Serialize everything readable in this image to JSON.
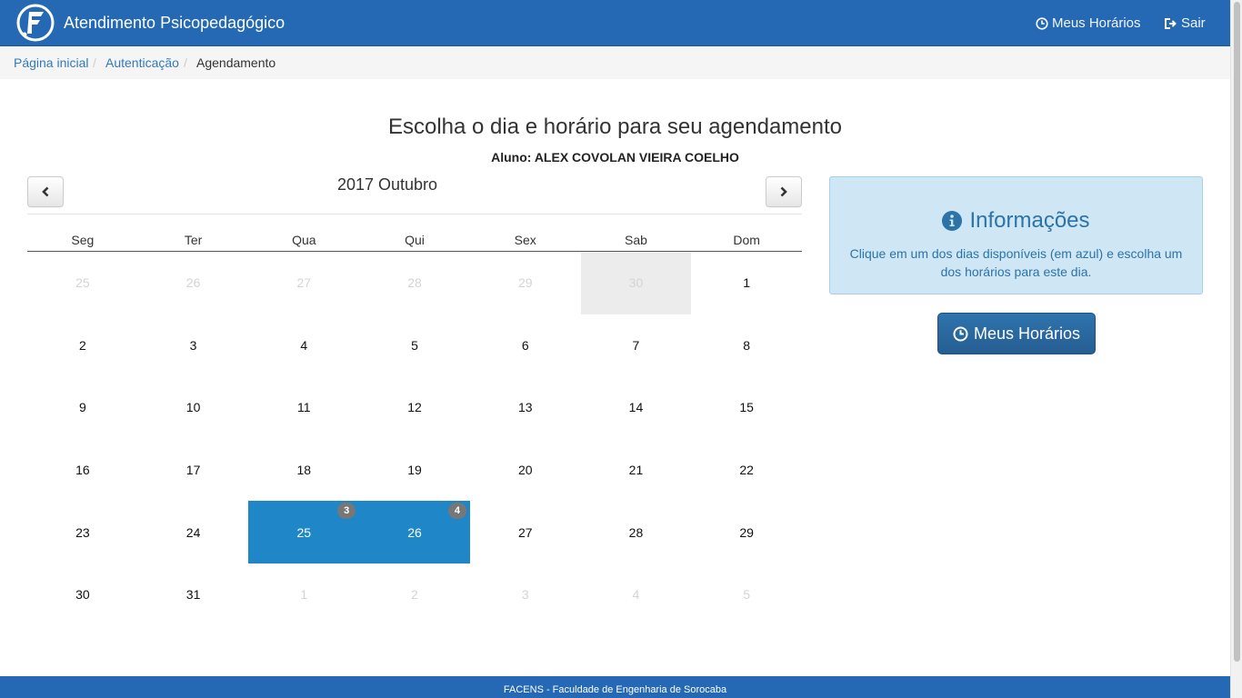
{
  "navbar": {
    "title": "Atendimento Psicopedagógico",
    "logo_icon": "facens-logo-icon",
    "links": [
      {
        "label": "Meus Horários",
        "icon": "clock-icon"
      },
      {
        "label": "Sair",
        "icon": "sign-out-icon"
      }
    ]
  },
  "breadcrumb": {
    "items": [
      "Página inicial",
      "Autenticação",
      "Agendamento"
    ],
    "separator": "/"
  },
  "heading": {
    "title": "Escolha o dia e horário para seu agendamento",
    "student": "Aluno: ALEX COVOLAN VIEIRA COELHO"
  },
  "calendar": {
    "month_label": "2017 Outubro",
    "prev_icon": "chevron-left-icon",
    "next_icon": "chevron-right-icon",
    "weekdays": [
      "Seg",
      "Ter",
      "Qua",
      "Qui",
      "Sex",
      "Sab",
      "Dom"
    ],
    "weeks": [
      [
        {
          "d": "25",
          "s": "other"
        },
        {
          "d": "26",
          "s": "other"
        },
        {
          "d": "27",
          "s": "other"
        },
        {
          "d": "28",
          "s": "other"
        },
        {
          "d": "29",
          "s": "other"
        },
        {
          "d": "30",
          "s": "other today"
        },
        {
          "d": "1",
          "s": ""
        }
      ],
      [
        {
          "d": "2",
          "s": ""
        },
        {
          "d": "3",
          "s": ""
        },
        {
          "d": "4",
          "s": ""
        },
        {
          "d": "5",
          "s": ""
        },
        {
          "d": "6",
          "s": ""
        },
        {
          "d": "7",
          "s": ""
        },
        {
          "d": "8",
          "s": ""
        }
      ],
      [
        {
          "d": "9",
          "s": ""
        },
        {
          "d": "10",
          "s": ""
        },
        {
          "d": "11",
          "s": ""
        },
        {
          "d": "12",
          "s": ""
        },
        {
          "d": "13",
          "s": ""
        },
        {
          "d": "14",
          "s": ""
        },
        {
          "d": "15",
          "s": ""
        }
      ],
      [
        {
          "d": "16",
          "s": ""
        },
        {
          "d": "17",
          "s": ""
        },
        {
          "d": "18",
          "s": ""
        },
        {
          "d": "19",
          "s": ""
        },
        {
          "d": "20",
          "s": ""
        },
        {
          "d": "21",
          "s": ""
        },
        {
          "d": "22",
          "s": ""
        }
      ],
      [
        {
          "d": "23",
          "s": ""
        },
        {
          "d": "24",
          "s": ""
        },
        {
          "d": "25",
          "s": "available",
          "badge": "3"
        },
        {
          "d": "26",
          "s": "available",
          "badge": "4"
        },
        {
          "d": "27",
          "s": ""
        },
        {
          "d": "28",
          "s": ""
        },
        {
          "d": "29",
          "s": ""
        }
      ],
      [
        {
          "d": "30",
          "s": ""
        },
        {
          "d": "31",
          "s": ""
        },
        {
          "d": "1",
          "s": "other"
        },
        {
          "d": "2",
          "s": "other"
        },
        {
          "d": "3",
          "s": "other"
        },
        {
          "d": "4",
          "s": "other"
        },
        {
          "d": "5",
          "s": "other"
        }
      ]
    ],
    "colors": {
      "available": "#1f86c8",
      "today": "#ececec",
      "badge": "#777777"
    }
  },
  "info": {
    "title": "Informações",
    "icon": "info-circle-icon",
    "text": "Clique em um dos dias disponíveis (em azul) e escolha um dos horários para este dia."
  },
  "meus_horarios_button": {
    "label": "Meus Horários",
    "icon": "clock-icon"
  },
  "footer": {
    "text": "FACENS - Faculdade de Engenharia de Sorocaba"
  },
  "colors": {
    "brand": "#2569b5",
    "link": "#337ab7",
    "info_bg": "#cfe6f5",
    "info_text": "#2c73a8"
  }
}
